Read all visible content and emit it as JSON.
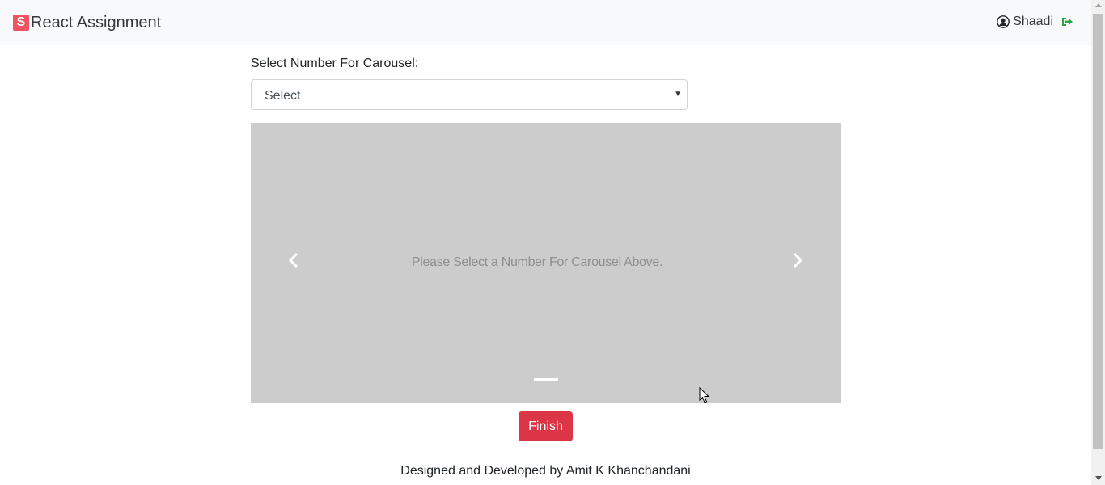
{
  "navbar": {
    "logo_letter": "S",
    "brand_title": "React Assignment",
    "user_name": "Shaadi",
    "user_icon": "user-circle-icon",
    "logout_icon": "sign-out-icon",
    "logout_color": "#28a745"
  },
  "form": {
    "label": "Select Number For Carousel:",
    "select_value": "Select"
  },
  "carousel": {
    "message": "Please Select a Number For Carousel Above.",
    "prev_icon": "chevron-left-icon",
    "next_icon": "chevron-right-icon",
    "background": "#cccccc"
  },
  "actions": {
    "finish_label": "Finish",
    "finish_color": "#dc3545"
  },
  "footer": {
    "text": "Designed and Developed by Amit K Khanchandani"
  }
}
